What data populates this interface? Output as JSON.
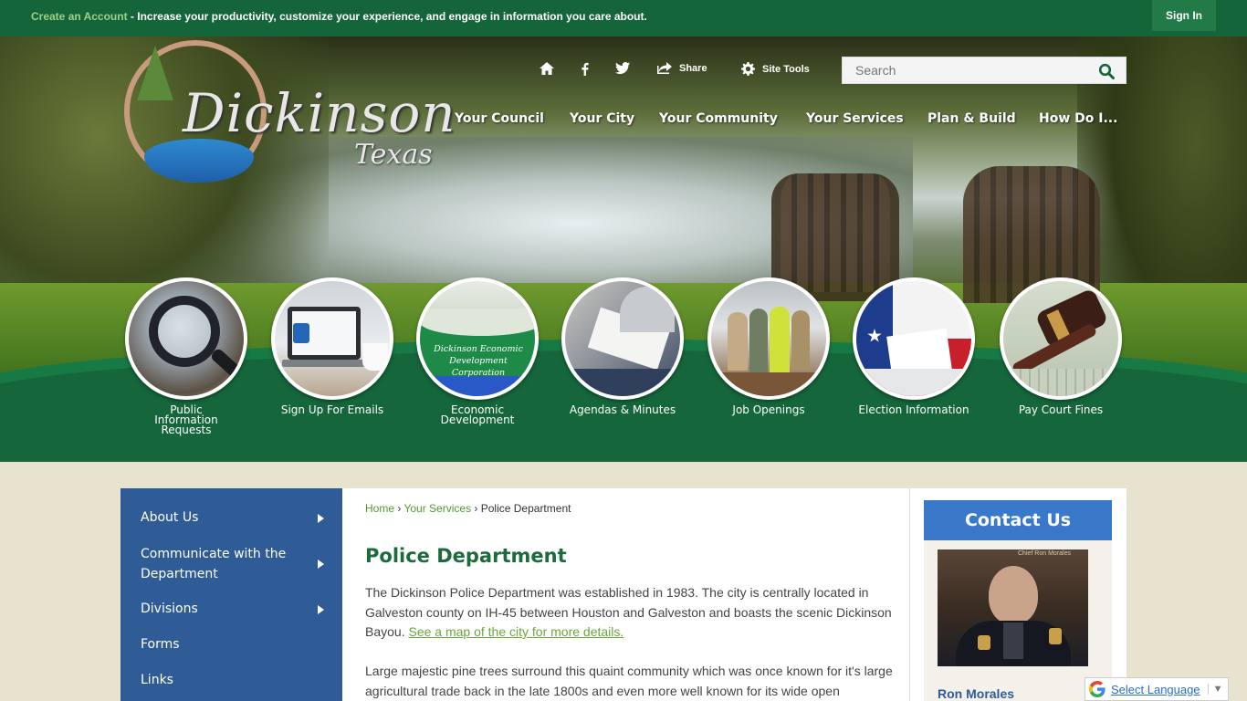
{
  "topbar": {
    "account_link": "Create an Account",
    "message": " - Increase your productivity, customize your experience, and engage in information you care about.",
    "signin": "Sign In"
  },
  "logo": {
    "name": "Dickinson",
    "state": "Texas"
  },
  "utility": {
    "share": "Share",
    "site_tools": "Site Tools",
    "search_placeholder": "Search"
  },
  "nav": [
    "Your Council",
    "Your City",
    "Your Community",
    "Your Services",
    "Plan & Build",
    "How Do I..."
  ],
  "quick_links": [
    {
      "label": "Public Information Requests"
    },
    {
      "label": "Sign Up For Emails"
    },
    {
      "label": "Economic Development",
      "badge": "Dickinson Economic Development Corporation"
    },
    {
      "label": "Agendas & Minutes"
    },
    {
      "label": "Job Openings"
    },
    {
      "label": "Election Information"
    },
    {
      "label": "Pay Court Fines"
    }
  ],
  "sidebar": [
    {
      "label": "About Us",
      "arrow": true
    },
    {
      "label": "Communicate with the Department",
      "arrow": true
    },
    {
      "label": "Divisions",
      "arrow": true
    },
    {
      "label": "Forms",
      "arrow": false
    },
    {
      "label": "Links",
      "arrow": false
    }
  ],
  "breadcrumb": {
    "home": "Home",
    "section": "Your Services",
    "current": "Police Department",
    "sep": " › "
  },
  "page": {
    "title": "Police Department",
    "para1": "The Dickinson Police Department was established in 1983. The city is centrally located in Galveston county on IH-45 between Houston and Galveston and boasts the scenic Dickinson Bayou. ",
    "para1_link": "See a map of the city for more details.",
    "para2": "Large majestic pine trees surround this quaint community which was once known for it's large agricultural trade back in the late 1800s and even more well known for its wide open"
  },
  "contact": {
    "heading": "Contact Us",
    "photo_caption": "Chief Ron Morales",
    "name": "Ron Morales"
  },
  "translate": {
    "label": "Select Language",
    "arrow": "▼"
  },
  "colors": {
    "topbar": "#14653a",
    "green_band": "#177a44",
    "sidebar": "#2f5c97",
    "title": "#1b6b3c",
    "contact_head": "#3a78c9",
    "link": "#6aa83a"
  }
}
